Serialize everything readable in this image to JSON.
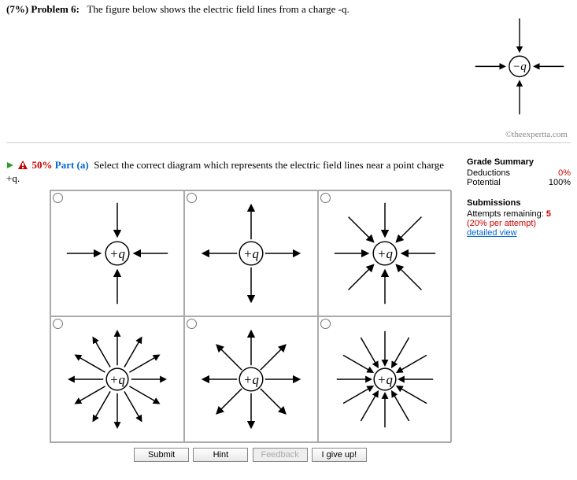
{
  "problem": {
    "weight": "(7%)",
    "label": "Problem 6:",
    "text": "The figure below shows the electric field lines from a charge -q.",
    "watermark": "©theexpertta.com",
    "header_charge": "−q"
  },
  "part": {
    "pct_label": "50%",
    "label": "Part (a)",
    "text": "Select the correct diagram which represents the electric field lines near a point charge +q."
  },
  "options": {
    "charge_label": "+q"
  },
  "buttons": {
    "submit": "Submit",
    "hint": "Hint",
    "feedback": "Feedback",
    "giveup": "I give up!"
  },
  "sidebar": {
    "grade_title": "Grade Summary",
    "deductions_label": "Deductions",
    "deductions_value": "0%",
    "potential_label": "Potential",
    "potential_value": "100%",
    "submissions_title": "Submissions",
    "attempts_label": "Attempts remaining:",
    "attempts_value": "5",
    "penalty_text": "(20% per attempt)",
    "detailed_view": "detailed view"
  }
}
